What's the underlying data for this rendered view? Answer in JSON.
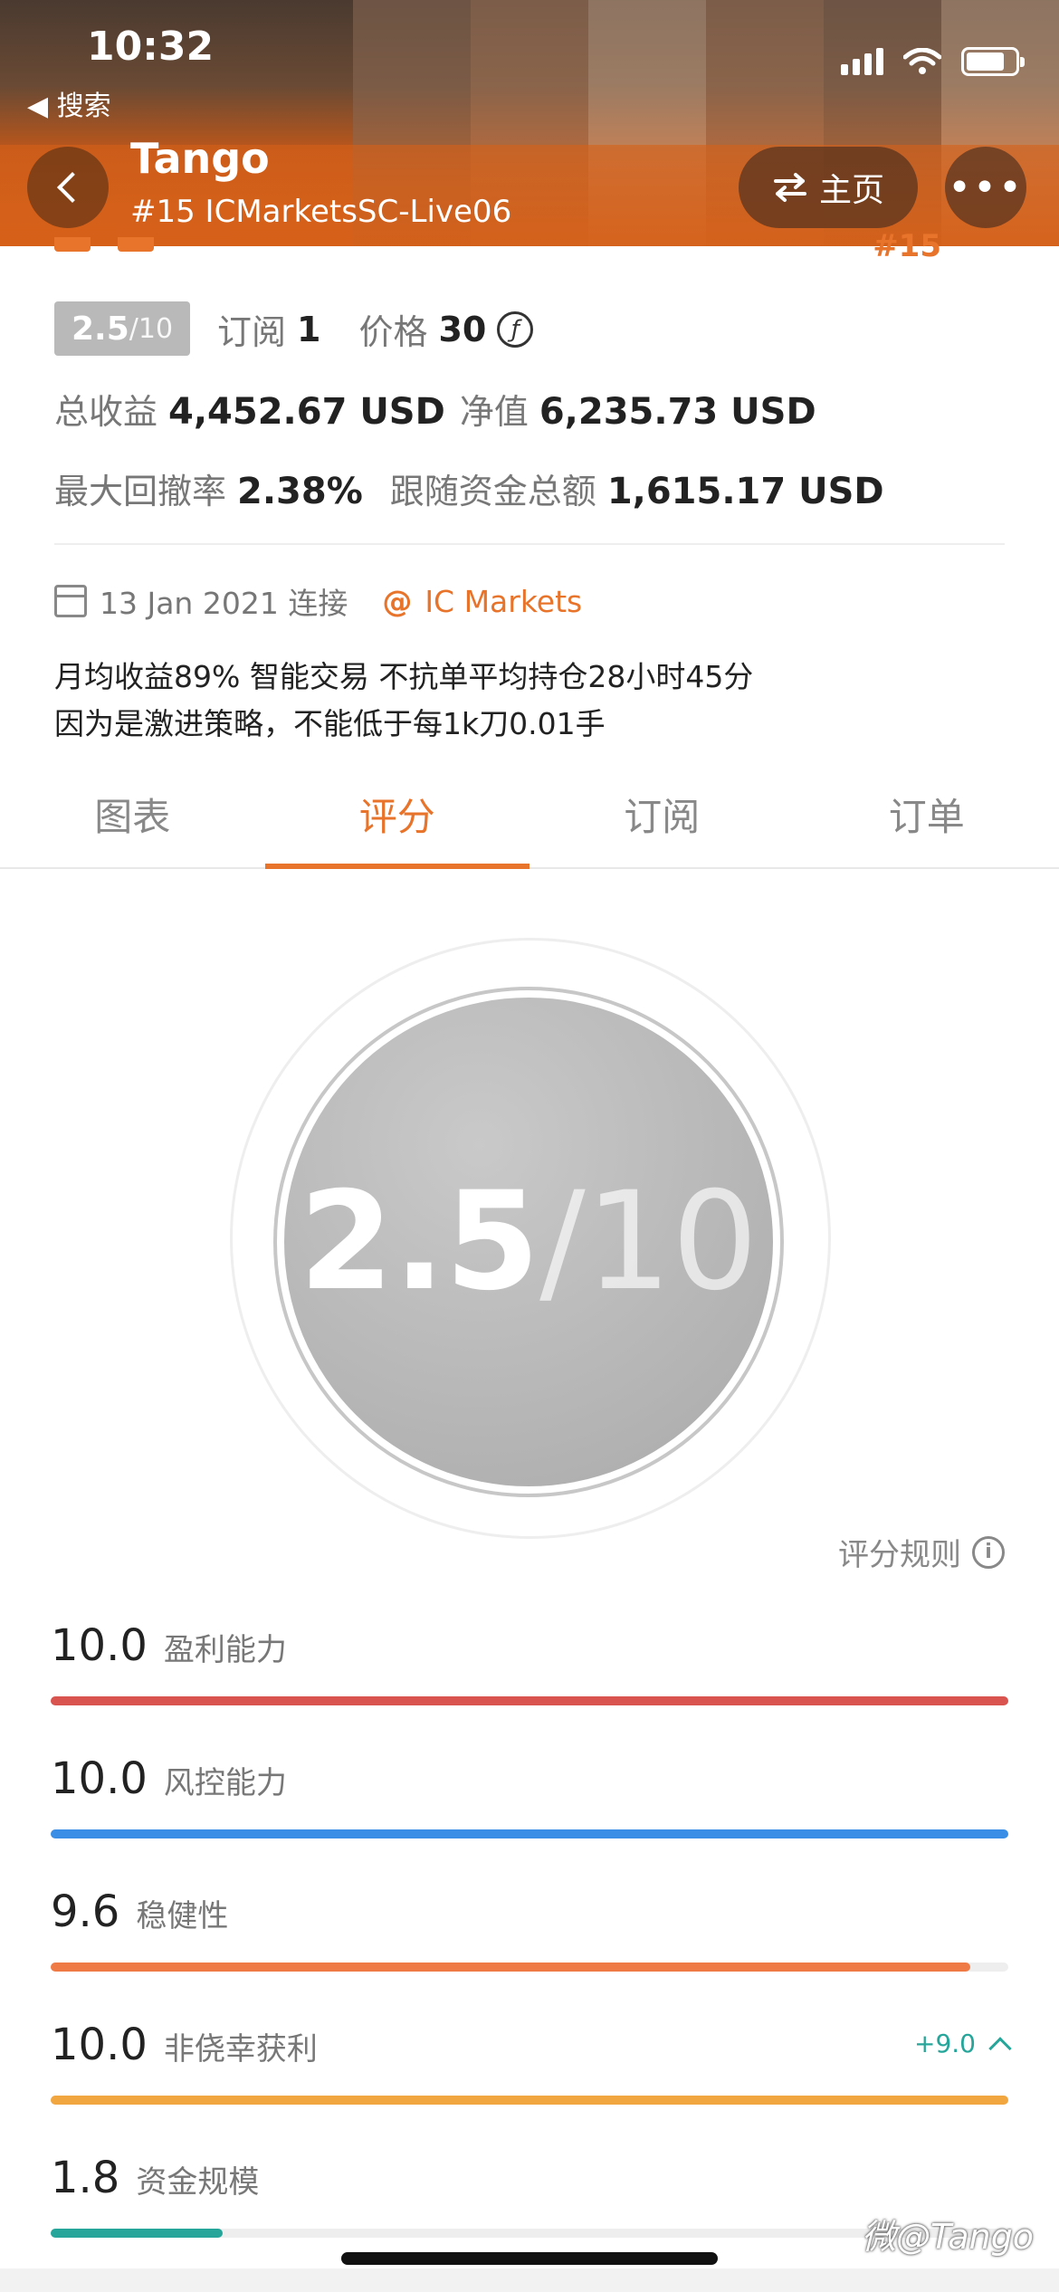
{
  "status": {
    "time": "10:32",
    "back_app": "◀ 搜索"
  },
  "nav": {
    "title": "Tango",
    "subtitle": "#15 ICMarketsSC-Live06",
    "home_label": "主页",
    "home_icon": "swap-arrows-icon",
    "more_icon": "ellipsis-icon",
    "more_label": "•••"
  },
  "peek_rank": "#15",
  "summary": {
    "score": "2.5",
    "score_max": "/10",
    "subs_label": "订阅",
    "subs_value": "1",
    "price_label": "价格",
    "price_value": "30",
    "price_icon": "ƒ",
    "total_profit_label": "总收益",
    "total_profit_value": "4,452.67 USD",
    "net_value_label": "净值",
    "net_value_value": "6,235.73 USD",
    "max_drawdown_label": "最大回撤率",
    "max_drawdown_value": "2.38%",
    "follow_funds_label": "跟随资金总额",
    "follow_funds_value": "1,615.17 USD"
  },
  "connect": {
    "date_text": "13 Jan 2021 连接",
    "at": "@",
    "broker": "IC Markets"
  },
  "description": {
    "line1": "月均收益89% 智能交易 不抗单平均持仓28小时45分",
    "line2": "因为是激进策略，不能低于每1k刀0.01手"
  },
  "tabs": [
    {
      "label": "图表"
    },
    {
      "label": "评分"
    },
    {
      "label": "订阅"
    },
    {
      "label": "订单"
    }
  ],
  "active_tab": "评分",
  "dial": {
    "score": "2.5",
    "max": "/10"
  },
  "rules_label": "评分规则",
  "rules_icon": "i",
  "metrics": [
    {
      "value": "10.0",
      "name": "盈利能力",
      "max": 10,
      "color": "#d9534f"
    },
    {
      "value": "10.0",
      "name": "风控能力",
      "max": 10,
      "color": "#3a8ee6"
    },
    {
      "value": "9.6",
      "name": "稳健性",
      "max": 10,
      "color": "#ef7a45"
    },
    {
      "value": "10.0",
      "name": "非侥幸获利",
      "max": 10,
      "color": "#f2a640",
      "delta": "+9.0"
    },
    {
      "value": "1.8",
      "name": "资金规模",
      "max": 10,
      "color": "#26a69a"
    }
  ],
  "watermark": "微@Tango"
}
